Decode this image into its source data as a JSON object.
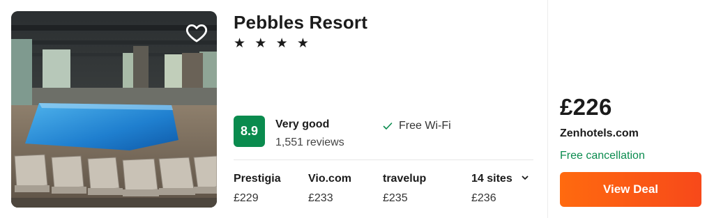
{
  "hotel": {
    "name": "Pebbles Resort",
    "stars_display": "★ ★ ★ ★",
    "star_count": 4,
    "photo_icon": "indoor-pool-photo",
    "favorite_icon": "heart-outline-icon"
  },
  "rating": {
    "score": "8.9",
    "verdict": "Very good",
    "reviews": "1,551 reviews",
    "score_color": "#0a8b4e"
  },
  "amenities": [
    {
      "label": "Free Wi-Fi",
      "icon": "check-icon"
    }
  ],
  "providers": [
    {
      "name": "Prestigia",
      "price": "£229"
    },
    {
      "name": "Vio.com",
      "price": "£233"
    },
    {
      "name": "travelup",
      "price": "£235"
    }
  ],
  "more_sites": {
    "label": "14 sites",
    "price": "£236",
    "icon": "chevron-down-icon"
  },
  "deal": {
    "price": "£226",
    "provider": "Zenhotels.com",
    "cancellation": "Free cancellation",
    "button_label": "View Deal",
    "button_color": "#f7491a",
    "cancel_color": "#0a8b4e"
  }
}
